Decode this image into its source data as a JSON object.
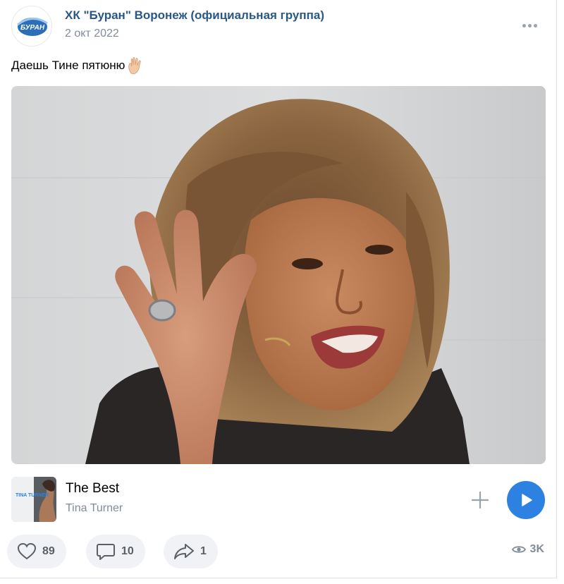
{
  "post": {
    "author": "ХК \"Буран\" Воронеж (официальная группа)",
    "date": "2 окт 2022",
    "text": "Даешь Тине пятюню",
    "emoji_icon": "raised-hand-emoji",
    "avatar_logo_text": "БУРАН"
  },
  "audio": {
    "title": "The Best",
    "artist": "Tina Turner",
    "cover_text": "TINA TURNER"
  },
  "actions": {
    "likes": "89",
    "comments": "10",
    "shares": "1",
    "views": "3K"
  },
  "colors": {
    "author_link": "#2a5885",
    "secondary_text": "#818c99",
    "play_button": "#2d81e0",
    "action_bg": "#f0f2f5"
  }
}
